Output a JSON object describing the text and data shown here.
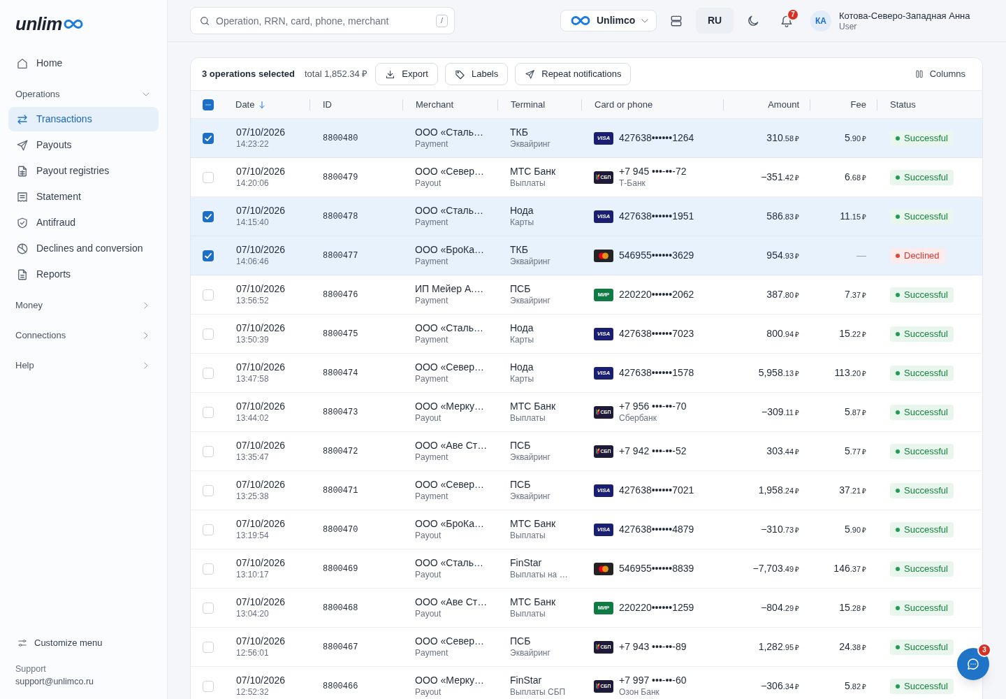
{
  "sidebar": {
    "logo": {
      "text": "unlim"
    },
    "nav": [
      {
        "kind": "link",
        "label": "Home",
        "selected": false
      },
      {
        "kind": "section",
        "label": "Operations",
        "expanded": true,
        "children": [
          {
            "label": "Transactions",
            "selected": true
          },
          {
            "label": "Payouts",
            "selected": false
          },
          {
            "label": "Payout registries",
            "selected": false
          },
          {
            "label": "Statement",
            "selected": false
          },
          {
            "label": "Antifraud",
            "selected": false
          },
          {
            "label": "Declines and conversion",
            "selected": false
          },
          {
            "label": "Reports",
            "selected": false
          }
        ]
      },
      {
        "kind": "section",
        "label": "Money",
        "expanded": false
      },
      {
        "kind": "section",
        "label": "Connections",
        "expanded": false
      },
      {
        "kind": "section",
        "label": "Help",
        "expanded": false
      }
    ],
    "customize": {
      "label": "Customize menu"
    },
    "support": {
      "title": "Support",
      "email": "support@unlimco.ru"
    }
  },
  "header": {
    "search": {
      "placeholder": "Operation, RRN, card, phone, merchant",
      "shortcut": "/"
    },
    "workspace": {
      "label": "Unlimco"
    },
    "language": "RU",
    "notifications": {
      "count": "7"
    },
    "user": {
      "initials": "КА",
      "name": "Котова-Северо-Западная Анна",
      "role": "User"
    }
  },
  "table": {
    "toolbar": {
      "selection": "3 operations selected",
      "total": "total 1,852.34 ₽",
      "actions": [
        {
          "label": "Export"
        },
        {
          "label": "Labels"
        },
        {
          "label": "Repeat notifications"
        }
      ],
      "columns_button": "Columns"
    },
    "select_all": {
      "indeterminate": true
    },
    "columns": [
      {
        "label": "Date",
        "kind": "text",
        "sorted": true
      },
      {
        "label": "ID",
        "kind": "text",
        "sorted": false
      },
      {
        "label": "Merchant",
        "kind": "text",
        "sorted": false
      },
      {
        "label": "Terminal",
        "kind": "text",
        "sorted": false
      },
      {
        "label": "Card or phone",
        "kind": "text",
        "sorted": false
      },
      {
        "label": "Amount",
        "kind": "numeric",
        "sorted": false
      },
      {
        "label": "Fee",
        "kind": "numeric",
        "sorted": false
      },
      {
        "label": "Status",
        "kind": "text",
        "sorted": false
      }
    ],
    "rows": [
      {
        "selected": true,
        "date": "07/10/2026",
        "time": "14:23:22",
        "id": "8800480",
        "merchant": "ООО «Сталь…",
        "operation_type": "Payment",
        "terminal": "ТКБ",
        "terminal_type": "Эквайринг",
        "payment": {
          "kind": "visa",
          "logo": "VISA",
          "number": "427638••••••1264"
        },
        "amount": {
          "main": "310",
          "minor": ".58",
          "currency": "₽"
        },
        "fee": {
          "main": "5",
          "minor": ".90",
          "currency": "₽"
        },
        "status": {
          "kind": "success",
          "label": "Successful"
        }
      },
      {
        "selected": false,
        "date": "07/10/2026",
        "time": "14:20:06",
        "id": "8800479",
        "merchant": "ООО «Север…",
        "operation_type": "Payout",
        "terminal": "МТС Банк",
        "terminal_type": "Выплаты",
        "payment": {
          "kind": "sbp",
          "logo": "СБП",
          "number": "+7 945 •••-••-72",
          "bank": "Т-Банк"
        },
        "amount": {
          "main": "−351",
          "minor": ".42",
          "currency": "₽"
        },
        "fee": {
          "main": "6",
          "minor": ".68",
          "currency": "₽"
        },
        "status": {
          "kind": "success",
          "label": "Successful"
        }
      },
      {
        "selected": true,
        "date": "07/10/2026",
        "time": "14:15:40",
        "id": "8800478",
        "merchant": "ООО «Сталь…",
        "operation_type": "Payment",
        "terminal": "Нода",
        "terminal_type": "Карты",
        "payment": {
          "kind": "visa",
          "logo": "VISA",
          "number": "427638••••••1951"
        },
        "amount": {
          "main": "586",
          "minor": ".83",
          "currency": "₽"
        },
        "fee": {
          "main": "11",
          "minor": ".15",
          "currency": "₽"
        },
        "status": {
          "kind": "success",
          "label": "Successful"
        }
      },
      {
        "selected": true,
        "date": "07/10/2026",
        "time": "14:06:46",
        "id": "8800477",
        "merchant": "ООО «БроКа…",
        "operation_type": "Payment",
        "terminal": "ТКБ",
        "terminal_type": "Эквайринг",
        "payment": {
          "kind": "mastercard",
          "number": "546955••••••3629"
        },
        "amount": {
          "main": "954",
          "minor": ".93",
          "currency": "₽"
        },
        "fee": {
          "main": "—"
        },
        "status": {
          "kind": "declined",
          "label": "Declined"
        }
      },
      {
        "selected": false,
        "date": "07/10/2026",
        "time": "13:56:52",
        "id": "8800476",
        "merchant": "ИП Мейер А.…",
        "operation_type": "Payment",
        "terminal": "ПСБ",
        "terminal_type": "Эквайринг",
        "payment": {
          "kind": "mir",
          "logo": "МИР",
          "number": "220220••••••2062"
        },
        "amount": {
          "main": "387",
          "minor": ".80",
          "currency": "₽"
        },
        "fee": {
          "main": "7",
          "minor": ".37",
          "currency": "₽"
        },
        "status": {
          "kind": "success",
          "label": "Successful"
        }
      },
      {
        "selected": false,
        "date": "07/10/2026",
        "time": "13:50:39",
        "id": "8800475",
        "merchant": "ООО «Сталь…",
        "operation_type": "Payment",
        "terminal": "Нода",
        "terminal_type": "Карты",
        "payment": {
          "kind": "visa",
          "logo": "VISA",
          "number": "427638••••••7023"
        },
        "amount": {
          "main": "800",
          "minor": ".94",
          "currency": "₽"
        },
        "fee": {
          "main": "15",
          "minor": ".22",
          "currency": "₽"
        },
        "status": {
          "kind": "success",
          "label": "Successful"
        }
      },
      {
        "selected": false,
        "date": "07/10/2026",
        "time": "13:47:58",
        "id": "8800474",
        "merchant": "ООО «Север…",
        "operation_type": "Payment",
        "terminal": "Нода",
        "terminal_type": "Карты",
        "payment": {
          "kind": "visa",
          "logo": "VISA",
          "number": "427638••••••1578"
        },
        "amount": {
          "main": "5,958",
          "minor": ".13",
          "currency": "₽"
        },
        "fee": {
          "main": "113",
          "minor": ".20",
          "currency": "₽"
        },
        "status": {
          "kind": "success",
          "label": "Successful"
        }
      },
      {
        "selected": false,
        "date": "07/10/2026",
        "time": "13:44:02",
        "id": "8800473",
        "merchant": "ООО «Мерку…",
        "operation_type": "Payout",
        "terminal": "МТС Банк",
        "terminal_type": "Выплаты",
        "payment": {
          "kind": "sbp",
          "logo": "СБП",
          "number": "+7 956 •••-••-70",
          "bank": "Сбербанк"
        },
        "amount": {
          "main": "−309",
          "minor": ".11",
          "currency": "₽"
        },
        "fee": {
          "main": "5",
          "minor": ".87",
          "currency": "₽"
        },
        "status": {
          "kind": "success",
          "label": "Successful"
        }
      },
      {
        "selected": false,
        "date": "07/10/2026",
        "time": "13:35:47",
        "id": "8800472",
        "merchant": "ООО «Аве Ст…",
        "operation_type": "Payment",
        "terminal": "ПСБ",
        "terminal_type": "Эквайринг",
        "payment": {
          "kind": "sbp",
          "logo": "СБП",
          "number": "+7 942 •••-••-52"
        },
        "amount": {
          "main": "303",
          "minor": ".44",
          "currency": "₽"
        },
        "fee": {
          "main": "5",
          "minor": ".77",
          "currency": "₽"
        },
        "status": {
          "kind": "success",
          "label": "Successful"
        }
      },
      {
        "selected": false,
        "date": "07/10/2026",
        "time": "13:25:38",
        "id": "8800471",
        "merchant": "ООО «Север…",
        "operation_type": "Payment",
        "terminal": "ПСБ",
        "terminal_type": "Эквайринг",
        "payment": {
          "kind": "visa",
          "logo": "VISA",
          "number": "427638••••••7021"
        },
        "amount": {
          "main": "1,958",
          "minor": ".24",
          "currency": "₽"
        },
        "fee": {
          "main": "37",
          "minor": ".21",
          "currency": "₽"
        },
        "status": {
          "kind": "success",
          "label": "Successful"
        }
      },
      {
        "selected": false,
        "date": "07/10/2026",
        "time": "13:19:54",
        "id": "8800470",
        "merchant": "ООО «БроКа…",
        "operation_type": "Payout",
        "terminal": "МТС Банк",
        "terminal_type": "Выплаты",
        "payment": {
          "kind": "visa",
          "logo": "VISA",
          "number": "427638••••••4879"
        },
        "amount": {
          "main": "−310",
          "minor": ".73",
          "currency": "₽"
        },
        "fee": {
          "main": "5",
          "minor": ".90",
          "currency": "₽"
        },
        "status": {
          "kind": "success",
          "label": "Successful"
        }
      },
      {
        "selected": false,
        "date": "07/10/2026",
        "time": "13:10:17",
        "id": "8800469",
        "merchant": "ООО «Сталь…",
        "operation_type": "Payout",
        "terminal": "FinStar",
        "terminal_type": "Выплаты на …",
        "payment": {
          "kind": "mastercard",
          "number": "546955••••••8839"
        },
        "amount": {
          "main": "−7,703",
          "minor": ".49",
          "currency": "₽"
        },
        "fee": {
          "main": "146",
          "minor": ".37",
          "currency": "₽"
        },
        "status": {
          "kind": "success",
          "label": "Successful"
        }
      },
      {
        "selected": false,
        "date": "07/10/2026",
        "time": "13:04:20",
        "id": "8800468",
        "merchant": "ООО «Аве Ст…",
        "operation_type": "Payout",
        "terminal": "МТС Банк",
        "terminal_type": "Выплаты",
        "payment": {
          "kind": "mir",
          "logo": "МИР",
          "number": "220220••••••1259"
        },
        "amount": {
          "main": "−804",
          "minor": ".29",
          "currency": "₽"
        },
        "fee": {
          "main": "15",
          "minor": ".28",
          "currency": "₽"
        },
        "status": {
          "kind": "success",
          "label": "Successful"
        }
      },
      {
        "selected": false,
        "date": "07/10/2026",
        "time": "12:56:01",
        "id": "8800467",
        "merchant": "ООО «Север…",
        "operation_type": "Payment",
        "terminal": "ПСБ",
        "terminal_type": "Эквайринг",
        "payment": {
          "kind": "sbp",
          "logo": "СБП",
          "number": "+7 943 •••-••-89"
        },
        "amount": {
          "main": "1,282",
          "minor": ".95",
          "currency": "₽"
        },
        "fee": {
          "main": "24",
          "minor": ".38",
          "currency": "₽"
        },
        "status": {
          "kind": "success",
          "label": "Successful"
        }
      },
      {
        "selected": false,
        "date": "07/10/2026",
        "time": "12:52:32",
        "id": "8800466",
        "merchant": "ООО «Мерку…",
        "operation_type": "Payout",
        "terminal": "FinStar",
        "terminal_type": "Выплаты СБП",
        "payment": {
          "kind": "sbp",
          "logo": "СБП",
          "number": "+7 997 •••-••-60",
          "bank": "Озон Банк"
        },
        "amount": {
          "main": "−306",
          "minor": ".34",
          "currency": "₽"
        },
        "fee": {
          "main": "5",
          "minor": ".82",
          "currency": "₽"
        },
        "status": {
          "kind": "success",
          "label": "Successful"
        }
      }
    ]
  },
  "chat": {
    "unread": "3"
  }
}
